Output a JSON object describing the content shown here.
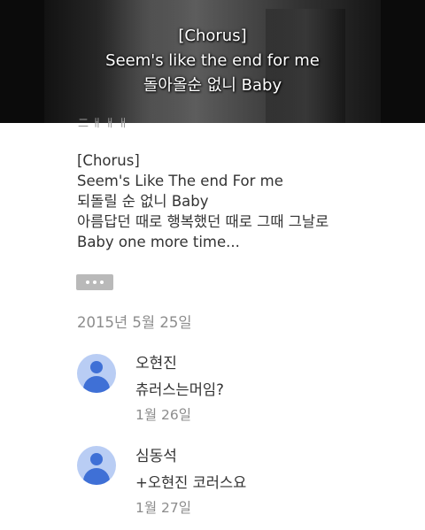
{
  "video": {
    "subtitle_lines": [
      "[Chorus]",
      "Seem's like the end for me",
      "돌아올순 없니 Baby"
    ]
  },
  "post": {
    "lyrics_lines": [
      "[Chorus]",
      "Seem's Like The end For me",
      "되돌릴 순 없니 Baby",
      "아름답던 때로 행복했던 때로 그때 그날로",
      "Baby one more time..."
    ],
    "date": "2015년 5월 25일"
  },
  "comments": [
    {
      "name": "오현진",
      "text": "츄러스는머임?",
      "date": "1월 26일",
      "avatar_icon": "default-user-icon"
    },
    {
      "name": "심동석",
      "text": "+오현진 코러스요",
      "date": "1월 27일",
      "avatar_icon": "default-user-icon"
    }
  ],
  "colors": {
    "avatar_bg": "#b9cdf4",
    "avatar_fg": "#3f70d6",
    "secondary_text": "#8c8c8c"
  }
}
